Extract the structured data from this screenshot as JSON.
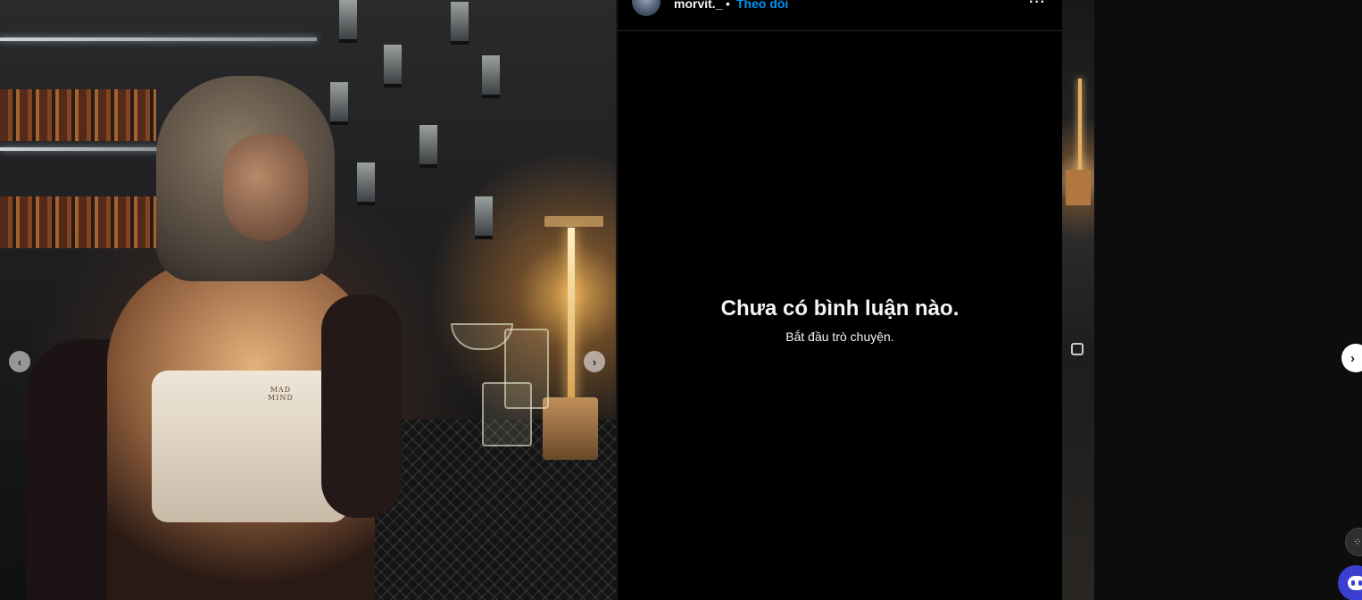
{
  "post": {
    "username": "morvit._",
    "separator": "•",
    "follow_label": "Theo dõi",
    "more_label": "···",
    "top_print": "MAD\nMIND"
  },
  "comments": {
    "empty_title": "Chưa có bình luận nào.",
    "empty_subtitle": "Bắt đầu trò chuyện."
  },
  "carousel": {
    "prev_label": "‹",
    "next_label": "›",
    "next_post_label": "›"
  },
  "icons": {
    "avatar": "profile-avatar",
    "more": "more-options-icon",
    "multi_image": "carousel-multi-icon",
    "floating_1": "extension-icon",
    "floating_2": "assistant-bot-icon"
  },
  "colors": {
    "panel_bg": "#000000",
    "follow_blue": "#0095f6",
    "divider": "#262626",
    "text": "#f5f5f5"
  }
}
